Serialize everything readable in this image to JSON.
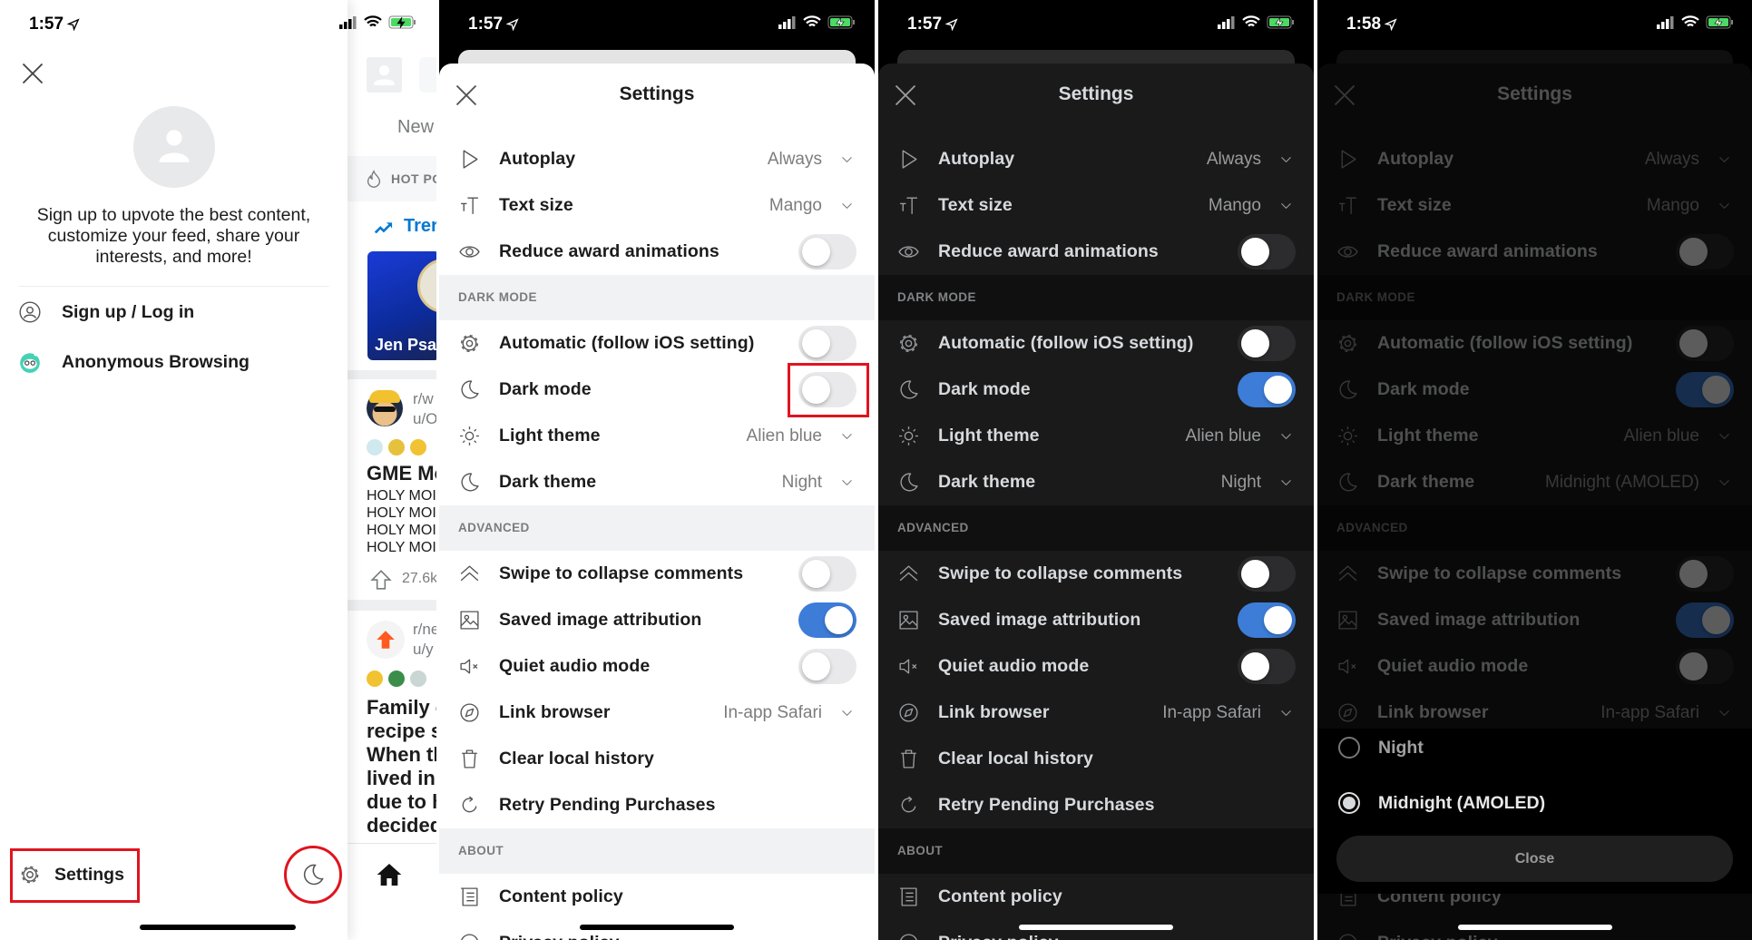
{
  "drawer": {
    "time": "1:57",
    "prompt": "Sign up to upvote the best content, customize your feed, share your interests, and more!",
    "signup_label": "Sign up / Log in",
    "anon_label": "Anonymous Browsing",
    "settings_label": "Settings"
  },
  "feed": {
    "new_label": "New",
    "hot_label": "HOT PO",
    "trending_label": "Trer",
    "image_caption": "Jen Psa",
    "post1": {
      "sub": "r/w",
      "user": "u/O",
      "title": "GME Mo",
      "body": [
        "HOLY MOI",
        "HOLY MOI",
        "HOLY MOI",
        "HOLY MOI"
      ],
      "votes": "27.6k"
    },
    "post2": {
      "sub": "r/ne",
      "user": "u/y",
      "title_lines": [
        "Family c",
        "recipe s",
        "When th",
        "lived in",
        "due to h",
        "decided"
      ]
    }
  },
  "colors": {
    "accent": "#0079d3",
    "toggle_on": "#3d7dd8",
    "highlight": "#e0141e",
    "trending": "#0079d3"
  },
  "settings": {
    "title": "Settings",
    "items": [
      {
        "type": "select",
        "icon": "play-icon",
        "label": "Autoplay"
      },
      {
        "type": "select",
        "icon": "text-size-icon",
        "label": "Text size"
      },
      {
        "type": "toggle",
        "icon": "eye-icon",
        "label": "Reduce award animations"
      },
      {
        "type": "section",
        "label": "DARK MODE"
      },
      {
        "type": "toggle",
        "icon": "gear-icon",
        "label": "Automatic (follow iOS setting)"
      },
      {
        "type": "toggle",
        "icon": "moon-icon",
        "label": "Dark mode"
      },
      {
        "type": "select",
        "icon": "sun-icon",
        "label": "Light theme"
      },
      {
        "type": "select",
        "icon": "moon-icon",
        "label": "Dark theme"
      },
      {
        "type": "section",
        "label": "ADVANCED"
      },
      {
        "type": "toggle",
        "icon": "chevron-up-icon",
        "label": "Swipe to collapse comments"
      },
      {
        "type": "toggle",
        "icon": "image-icon",
        "label": "Saved image attribution"
      },
      {
        "type": "toggle",
        "icon": "speaker-mute-icon",
        "label": "Quiet audio mode"
      },
      {
        "type": "select",
        "icon": "compass-icon",
        "label": "Link browser"
      },
      {
        "type": "action",
        "icon": "trash-icon",
        "label": "Clear local history"
      },
      {
        "type": "action",
        "icon": "refresh-icon",
        "label": "Retry Pending Purchases"
      },
      {
        "type": "section",
        "label": "ABOUT"
      },
      {
        "type": "action",
        "icon": "list-icon",
        "label": "Content policy"
      },
      {
        "type": "action",
        "icon": "shield-icon",
        "label": "Privacy policy"
      }
    ]
  },
  "screens": [
    {
      "time": "1:57",
      "theme": "light",
      "highlight_item": 5,
      "values": [
        "Always",
        "Mango",
        false,
        null,
        false,
        false,
        "Alien blue",
        "Night",
        null,
        false,
        true,
        false,
        "In-app Safari",
        null,
        null,
        null,
        null,
        null
      ]
    },
    {
      "time": "1:57",
      "theme": "dark",
      "values": [
        "Always",
        "Mango",
        false,
        null,
        false,
        true,
        "Alien blue",
        "Night",
        null,
        false,
        true,
        false,
        "In-app Safari",
        null,
        null,
        null,
        null,
        null
      ]
    },
    {
      "time": "1:58",
      "theme": "dim",
      "values": [
        "Always",
        "Mango",
        false,
        null,
        false,
        true,
        "Alien blue",
        "Midnight (AMOLED)",
        null,
        false,
        true,
        false,
        "In-app Safari",
        null,
        null,
        null,
        null,
        null
      ],
      "picker": {
        "options": [
          "Night",
          "Midnight (AMOLED)"
        ],
        "selected": "Midnight (AMOLED)",
        "close_label": "Close"
      }
    }
  ]
}
